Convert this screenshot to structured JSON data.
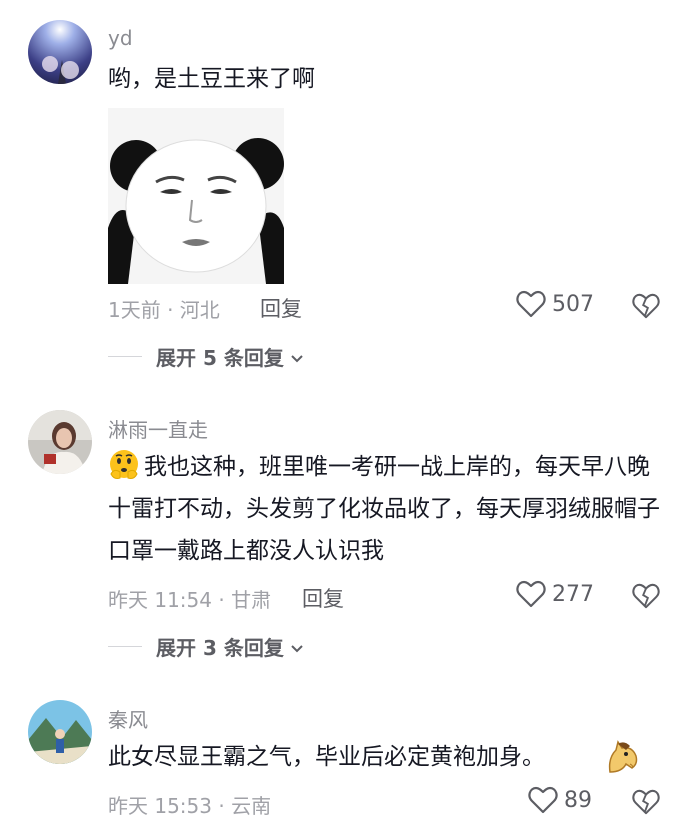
{
  "comments": [
    {
      "username": "yd",
      "text": "哟，是土豆王来了啊",
      "time_location": "1天前 · 河北",
      "reply_label": "回复",
      "likes": "507",
      "expand_label": "展开 5 条回复",
      "sticker": "panda-meme-sticker"
    },
    {
      "username": "淋雨一直走",
      "text": "我也这种，班里唯一考研一战上岸的，每天早八晚十雷打不动，头发剪了化妆品收了，每天厚羽绒服帽子口罩一戴路上都没人认识我",
      "leading_emoji": "thinking-face-emoji",
      "time_location": "昨天 11:54 · 甘肃",
      "reply_label": "回复",
      "likes": "277",
      "expand_label": "展开 3 条回复"
    },
    {
      "username": "秦风",
      "text": "此女尽显王霸之气，毕业后必定黄袍加身。",
      "trailing_emoji": "horse-emoji",
      "time_location": "昨天 15:53 · 云南",
      "likes": "89"
    }
  ],
  "colors": {
    "text_primary": "#161823",
    "text_secondary": "#8a8b91",
    "meta": "#a0a1a7"
  }
}
